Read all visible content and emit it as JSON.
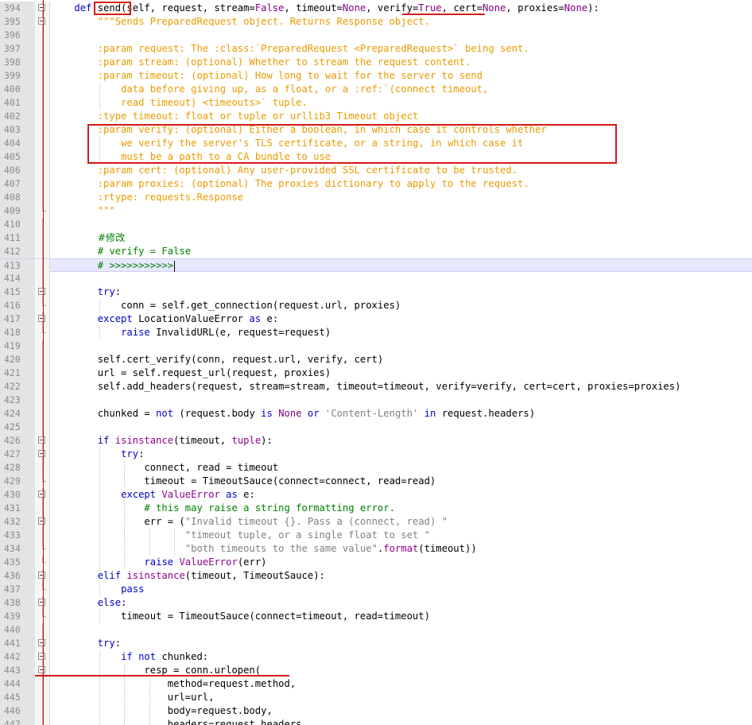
{
  "editor": {
    "lines": [
      {
        "n": "394",
        "fold": "box",
        "tokens": [
          [
            "    ",
            ""
          ],
          [
            "def",
            "kw"
          ],
          [
            " send",
            "fn"
          ],
          [
            "(self, request, stream=",
            ""
          ],
          [
            "False",
            "cn"
          ],
          [
            ", timeout=",
            ""
          ],
          [
            "None",
            "cn"
          ],
          [
            ", verify=",
            ""
          ],
          [
            "True",
            "cn"
          ],
          [
            ", cert=",
            ""
          ],
          [
            "None",
            "cn"
          ],
          [
            ", proxies=",
            ""
          ],
          [
            "None",
            "cn"
          ],
          [
            "):",
            ""
          ]
        ]
      },
      {
        "n": "395",
        "fold": "box",
        "tokens": [
          [
            "        ",
            ""
          ],
          [
            "\"\"\"Sends PreparedRequest object. Returns Response object.",
            "str"
          ]
        ]
      },
      {
        "n": "396",
        "fold": "line",
        "tokens": []
      },
      {
        "n": "397",
        "fold": "line",
        "tokens": [
          [
            "        ",
            ""
          ],
          [
            ":param request: The :class:`PreparedRequest <PreparedRequest>` being sent.",
            "str"
          ]
        ]
      },
      {
        "n": "398",
        "fold": "line",
        "tokens": [
          [
            "        ",
            ""
          ],
          [
            ":param stream: (optional) Whether to stream the request content.",
            "str"
          ]
        ]
      },
      {
        "n": "399",
        "fold": "line",
        "tokens": [
          [
            "        ",
            ""
          ],
          [
            ":param timeout: (optional) How long to wait for the server to send",
            "str"
          ]
        ]
      },
      {
        "n": "400",
        "fold": "line",
        "tokens": [
          [
            "            ",
            ""
          ],
          [
            "data before giving up, as a float, or a :ref:`(connect timeout,",
            "str"
          ]
        ]
      },
      {
        "n": "401",
        "fold": "line",
        "tokens": [
          [
            "            ",
            ""
          ],
          [
            "read timeout) <timeouts>` tuple.",
            "str"
          ]
        ]
      },
      {
        "n": "402",
        "fold": "line",
        "tokens": [
          [
            "        ",
            ""
          ],
          [
            ":type timeout: float or tuple or urllib3 Timeout object",
            "str"
          ]
        ]
      },
      {
        "n": "403",
        "fold": "line",
        "tokens": [
          [
            "        ",
            ""
          ],
          [
            ":param verify: (optional) Either a boolean, in which case it controls whether",
            "str"
          ]
        ]
      },
      {
        "n": "404",
        "fold": "line",
        "tokens": [
          [
            "            ",
            ""
          ],
          [
            "we verify the server's TLS certificate, or a string, in which case it",
            "str"
          ]
        ]
      },
      {
        "n": "405",
        "fold": "line",
        "tokens": [
          [
            "            ",
            ""
          ],
          [
            "must be a path to a CA bundle to use",
            "str"
          ]
        ]
      },
      {
        "n": "406",
        "fold": "line",
        "tokens": [
          [
            "        ",
            ""
          ],
          [
            ":param cert: (optional) Any user-provided SSL certificate to be trusted.",
            "str"
          ]
        ]
      },
      {
        "n": "407",
        "fold": "line",
        "tokens": [
          [
            "        ",
            ""
          ],
          [
            ":param proxies: (optional) The proxies dictionary to apply to the request.",
            "str"
          ]
        ]
      },
      {
        "n": "408",
        "fold": "line",
        "tokens": [
          [
            "        ",
            ""
          ],
          [
            ":rtype: requests.Response",
            "str"
          ]
        ]
      },
      {
        "n": "409",
        "fold": "end",
        "tokens": [
          [
            "        ",
            ""
          ],
          [
            "\"\"\"",
            "str"
          ]
        ]
      },
      {
        "n": "410",
        "fold": "line",
        "tokens": []
      },
      {
        "n": "411",
        "fold": "line",
        "tokens": [
          [
            "        ",
            ""
          ],
          [
            "#修改",
            "cm"
          ]
        ]
      },
      {
        "n": "412",
        "fold": "line",
        "tokens": [
          [
            "        ",
            ""
          ],
          [
            "# verify = False",
            "cm"
          ]
        ]
      },
      {
        "n": "413",
        "fold": "line",
        "current": true,
        "caret": true,
        "tokens": [
          [
            "        ",
            ""
          ],
          [
            "# >>>>>>>>>>>",
            "cm"
          ]
        ]
      },
      {
        "n": "414",
        "fold": "line",
        "tokens": []
      },
      {
        "n": "415",
        "fold": "box",
        "tokens": [
          [
            "        ",
            ""
          ],
          [
            "try",
            "kw"
          ],
          [
            ":",
            ""
          ]
        ]
      },
      {
        "n": "416",
        "fold": "end",
        "tokens": [
          [
            "            conn = self.get_connection(request.url, proxies)",
            ""
          ]
        ]
      },
      {
        "n": "417",
        "fold": "box",
        "tokens": [
          [
            "        ",
            ""
          ],
          [
            "except",
            "kw"
          ],
          [
            " LocationValueError ",
            ""
          ],
          [
            "as",
            "kw"
          ],
          [
            " e:",
            ""
          ]
        ]
      },
      {
        "n": "418",
        "fold": "end",
        "tokens": [
          [
            "            ",
            ""
          ],
          [
            "raise",
            "kw"
          ],
          [
            " InvalidURL(e, request=request)",
            ""
          ]
        ]
      },
      {
        "n": "419",
        "fold": "line",
        "tokens": []
      },
      {
        "n": "420",
        "fold": "line",
        "tokens": [
          [
            "        self.cert_verify(conn, request.url, verify, cert)",
            ""
          ]
        ]
      },
      {
        "n": "421",
        "fold": "line",
        "tokens": [
          [
            "        url = self.request_url(request, proxies)",
            ""
          ]
        ]
      },
      {
        "n": "422",
        "fold": "line",
        "tokens": [
          [
            "        self.add_headers(request, stream=stream, timeout=timeout, verify=verify, cert=cert, proxies=proxies)",
            ""
          ]
        ]
      },
      {
        "n": "423",
        "fold": "line",
        "tokens": []
      },
      {
        "n": "424",
        "fold": "line",
        "tokens": [
          [
            "        chunked = ",
            ""
          ],
          [
            "not",
            "kw"
          ],
          [
            " (request.body ",
            ""
          ],
          [
            "is",
            "kw"
          ],
          [
            " ",
            ""
          ],
          [
            "None",
            "cn"
          ],
          [
            " ",
            ""
          ],
          [
            "or",
            "kw"
          ],
          [
            " ",
            ""
          ],
          [
            "'Content-Length'",
            "gstr"
          ],
          [
            " ",
            ""
          ],
          [
            "in",
            "kw"
          ],
          [
            " request.headers)",
            ""
          ]
        ]
      },
      {
        "n": "425",
        "fold": "line",
        "tokens": []
      },
      {
        "n": "426",
        "fold": "box",
        "tokens": [
          [
            "        ",
            ""
          ],
          [
            "if",
            "kw"
          ],
          [
            " ",
            ""
          ],
          [
            "isinstance",
            "bi"
          ],
          [
            "(timeout, ",
            ""
          ],
          [
            "tuple",
            "bi"
          ],
          [
            "):",
            ""
          ]
        ]
      },
      {
        "n": "427",
        "fold": "box",
        "tokens": [
          [
            "            ",
            ""
          ],
          [
            "try",
            "kw"
          ],
          [
            ":",
            ""
          ]
        ]
      },
      {
        "n": "428",
        "fold": "line",
        "tokens": [
          [
            "                connect, read = timeout",
            ""
          ]
        ]
      },
      {
        "n": "429",
        "fold": "end",
        "tokens": [
          [
            "                timeout = TimeoutSauce(connect=connect, read=read)",
            ""
          ]
        ]
      },
      {
        "n": "430",
        "fold": "box",
        "tokens": [
          [
            "            ",
            ""
          ],
          [
            "except",
            "kw"
          ],
          [
            " ",
            ""
          ],
          [
            "ValueError",
            "bi"
          ],
          [
            " ",
            ""
          ],
          [
            "as",
            "kw"
          ],
          [
            " e:",
            ""
          ]
        ]
      },
      {
        "n": "431",
        "fold": "line",
        "tokens": [
          [
            "                ",
            ""
          ],
          [
            "# this may raise a string formatting error.",
            "cm"
          ]
        ]
      },
      {
        "n": "432",
        "fold": "box",
        "tokens": [
          [
            "                err = (",
            ""
          ],
          [
            "\"Invalid timeout {}. Pass a (connect, read) \"",
            "gstr"
          ]
        ]
      },
      {
        "n": "433",
        "fold": "line",
        "tokens": [
          [
            "                       ",
            ""
          ],
          [
            "\"timeout tuple, or a single float to set \"",
            "gstr"
          ]
        ]
      },
      {
        "n": "434",
        "fold": "end",
        "tokens": [
          [
            "                       ",
            ""
          ],
          [
            "\"both timeouts to the same value\"",
            "gstr"
          ],
          [
            ".",
            ""
          ],
          [
            "format",
            "bi"
          ],
          [
            "(timeout))",
            ""
          ]
        ]
      },
      {
        "n": "435",
        "fold": "end",
        "tokens": [
          [
            "                ",
            ""
          ],
          [
            "raise",
            "kw"
          ],
          [
            " ",
            ""
          ],
          [
            "ValueError",
            "bi"
          ],
          [
            "(err)",
            ""
          ]
        ]
      },
      {
        "n": "436",
        "fold": "box",
        "tokens": [
          [
            "        ",
            ""
          ],
          [
            "elif",
            "kw"
          ],
          [
            " ",
            ""
          ],
          [
            "isinstance",
            "bi"
          ],
          [
            "(timeout, TimeoutSauce):",
            ""
          ]
        ]
      },
      {
        "n": "437",
        "fold": "end",
        "tokens": [
          [
            "            ",
            ""
          ],
          [
            "pass",
            "kw"
          ]
        ]
      },
      {
        "n": "438",
        "fold": "box",
        "tokens": [
          [
            "        ",
            ""
          ],
          [
            "else",
            "kw"
          ],
          [
            ":",
            ""
          ]
        ]
      },
      {
        "n": "439",
        "fold": "end",
        "tokens": [
          [
            "            timeout = TimeoutSauce(connect=timeout, read=timeout)",
            ""
          ]
        ]
      },
      {
        "n": "440",
        "fold": "line",
        "tokens": []
      },
      {
        "n": "441",
        "fold": "box",
        "tokens": [
          [
            "        ",
            ""
          ],
          [
            "try",
            "kw"
          ],
          [
            ":",
            ""
          ]
        ]
      },
      {
        "n": "442",
        "fold": "box",
        "tokens": [
          [
            "            ",
            ""
          ],
          [
            "if",
            "kw"
          ],
          [
            " ",
            ""
          ],
          [
            "not",
            "kw"
          ],
          [
            " chunked:",
            ""
          ]
        ]
      },
      {
        "n": "443",
        "fold": "box",
        "tokens": [
          [
            "                resp = conn.urlopen(",
            ""
          ]
        ]
      },
      {
        "n": "444",
        "fold": "line",
        "tokens": [
          [
            "                    method=request.method,",
            ""
          ]
        ]
      },
      {
        "n": "445",
        "fold": "line",
        "tokens": [
          [
            "                    url=url,",
            ""
          ]
        ]
      },
      {
        "n": "446",
        "fold": "line",
        "tokens": [
          [
            "                    body=request.body,",
            ""
          ]
        ]
      },
      {
        "n": "447",
        "fold": "line",
        "tokens": [
          [
            "                    headers=request.headers,",
            ""
          ]
        ]
      }
    ]
  },
  "colors": {
    "keyword": "#0000c8",
    "builtin": "#900090",
    "constant": "#800080",
    "docstring": "#ea9a00",
    "string": "#808080",
    "comment": "#008000",
    "annotation": "#d81818",
    "current_line": "#e8e8ff",
    "gutter": "#e4e4e4"
  }
}
